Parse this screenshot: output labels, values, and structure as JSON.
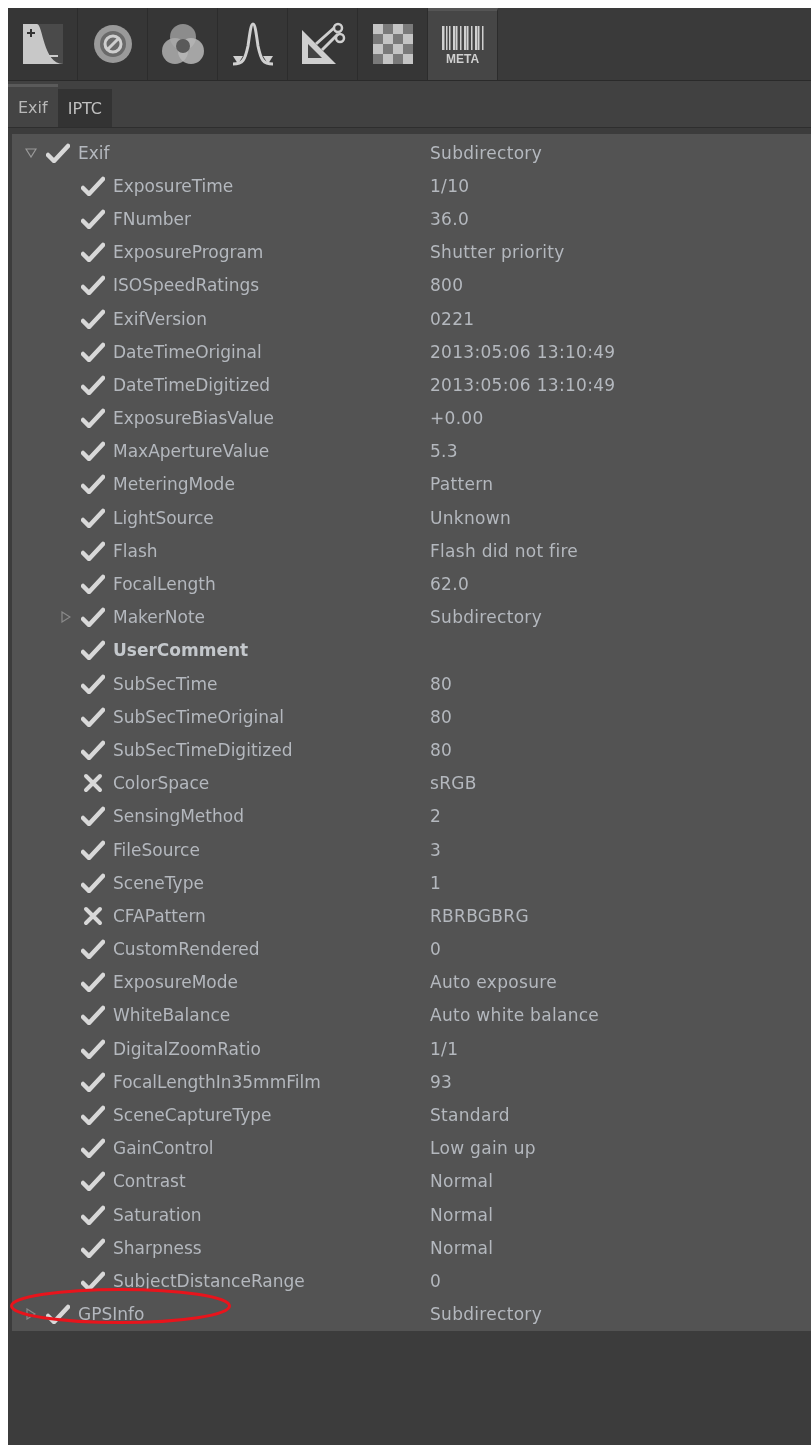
{
  "toolbar": [
    {
      "kind": "curve",
      "selected": false
    },
    {
      "kind": "target",
      "selected": false
    },
    {
      "kind": "circles",
      "selected": false
    },
    {
      "kind": "peak",
      "selected": false
    },
    {
      "kind": "tools",
      "selected": false
    },
    {
      "kind": "checker",
      "selected": false
    },
    {
      "kind": "meta",
      "label": "META",
      "selected": true
    }
  ],
  "tabs": [
    {
      "label": "Exif",
      "selected": true
    },
    {
      "label": "IPTC",
      "selected": false
    }
  ],
  "tree": [
    {
      "name": "Exif",
      "value": "Subdirectory",
      "enabled": true,
      "bold": false,
      "expanded": true,
      "circled": false,
      "children": [
        {
          "name": "ExposureTime",
          "value": "1/10",
          "enabled": true,
          "bold": false
        },
        {
          "name": "FNumber",
          "value": "36.0",
          "enabled": true,
          "bold": false
        },
        {
          "name": "ExposureProgram",
          "value": "Shutter priority",
          "enabled": true,
          "bold": false
        },
        {
          "name": "ISOSpeedRatings",
          "value": "800",
          "enabled": true,
          "bold": false
        },
        {
          "name": "ExifVersion",
          "value": "0221",
          "enabled": true,
          "bold": false
        },
        {
          "name": "DateTimeOriginal",
          "value": "2013:05:06 13:10:49",
          "enabled": true,
          "bold": false
        },
        {
          "name": "DateTimeDigitized",
          "value": "2013:05:06 13:10:49",
          "enabled": true,
          "bold": false
        },
        {
          "name": "ExposureBiasValue",
          "value": "+0.00",
          "enabled": true,
          "bold": false
        },
        {
          "name": "MaxApertureValue",
          "value": "5.3",
          "enabled": true,
          "bold": false
        },
        {
          "name": "MeteringMode",
          "value": "Pattern",
          "enabled": true,
          "bold": false
        },
        {
          "name": "LightSource",
          "value": "Unknown",
          "enabled": true,
          "bold": false
        },
        {
          "name": "Flash",
          "value": "Flash did not fire",
          "enabled": true,
          "bold": false
        },
        {
          "name": "FocalLength",
          "value": "62.0",
          "enabled": true,
          "bold": false
        },
        {
          "name": "MakerNote",
          "value": "Subdirectory",
          "enabled": true,
          "bold": false,
          "expanded": false
        },
        {
          "name": "UserComment",
          "enabled": true,
          "bold": true
        },
        {
          "name": "SubSecTime",
          "value": "80",
          "enabled": true,
          "bold": false
        },
        {
          "name": "SubSecTimeOriginal",
          "value": "80",
          "enabled": true,
          "bold": false
        },
        {
          "name": "SubSecTimeDigitized",
          "value": "80",
          "enabled": true,
          "bold": false
        },
        {
          "name": "ColorSpace",
          "value": "sRGB",
          "enabled": false,
          "bold": false
        },
        {
          "name": "SensingMethod",
          "value": "2",
          "enabled": true,
          "bold": false
        },
        {
          "name": "FileSource",
          "value": "3",
          "enabled": true,
          "bold": false
        },
        {
          "name": "SceneType",
          "value": "1",
          "enabled": true,
          "bold": false
        },
        {
          "name": "CFAPattern",
          "value": "RBRBGBRG",
          "enabled": false,
          "bold": false
        },
        {
          "name": "CustomRendered",
          "value": "0",
          "enabled": true,
          "bold": false
        },
        {
          "name": "ExposureMode",
          "value": "Auto exposure",
          "enabled": true,
          "bold": false
        },
        {
          "name": "WhiteBalance",
          "value": "Auto white balance",
          "enabled": true,
          "bold": false
        },
        {
          "name": "DigitalZoomRatio",
          "value": "1/1",
          "enabled": true,
          "bold": false
        },
        {
          "name": "FocalLengthIn35mmFilm",
          "value": "93",
          "enabled": true,
          "bold": false
        },
        {
          "name": "SceneCaptureType",
          "value": "Standard",
          "enabled": true,
          "bold": false
        },
        {
          "name": "GainControl",
          "value": "Low gain up",
          "enabled": true,
          "bold": false
        },
        {
          "name": "Contrast",
          "value": "Normal",
          "enabled": true,
          "bold": false
        },
        {
          "name": "Saturation",
          "value": "Normal",
          "enabled": true,
          "bold": false
        },
        {
          "name": "Sharpness",
          "value": "Normal",
          "enabled": true,
          "bold": false
        },
        {
          "name": "SubjectDistanceRange",
          "value": "0",
          "enabled": true,
          "bold": false
        }
      ]
    },
    {
      "name": "GPSInfo",
      "value": "Subdirectory",
      "enabled": true,
      "bold": false,
      "expanded": false,
      "circled": true
    }
  ]
}
